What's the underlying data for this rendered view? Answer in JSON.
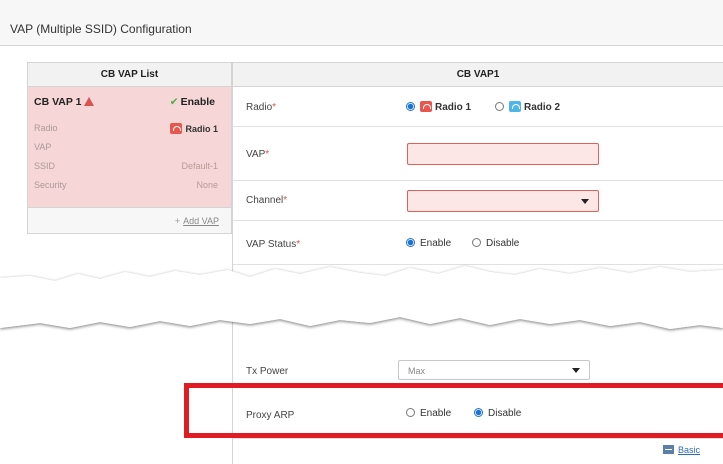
{
  "page": {
    "title": "VAP (Multiple SSID) Configuration"
  },
  "list_panel": {
    "header": "CB VAP List",
    "card": {
      "name": "CB VAP 1",
      "status": "Enable",
      "fields": [
        {
          "label": "Radio",
          "value": "Radio 1"
        },
        {
          "label": "VAP",
          "value": ""
        },
        {
          "label": "SSID",
          "value": "Default-1"
        },
        {
          "label": "Security",
          "value": "None"
        }
      ]
    },
    "add_label": "Add VAP"
  },
  "form": {
    "header": "CB VAP1",
    "radio": {
      "label": "Radio",
      "required": "*",
      "options": [
        "Radio 1",
        "Radio 2"
      ],
      "selected": "Radio 1"
    },
    "vap": {
      "label": "VAP",
      "required": "*",
      "value": ""
    },
    "channel": {
      "label": "Channel",
      "required": "*",
      "value": ""
    },
    "vap_status": {
      "label": "VAP Status",
      "required": "*",
      "options": [
        "Enable",
        "Disable"
      ],
      "selected": "Enable"
    },
    "tx_power": {
      "label": "Tx Power",
      "value": "Max"
    },
    "proxy_arp": {
      "label": "Proxy ARP",
      "options": [
        "Enable",
        "Disable"
      ],
      "selected": "Disable"
    }
  },
  "footer": {
    "basic_label": "Basic"
  },
  "colors": {
    "error_bg": "#fde6e6",
    "card_bg": "#f6d6d6",
    "highlight": "#e01b24",
    "accent": "#1e73d8"
  }
}
